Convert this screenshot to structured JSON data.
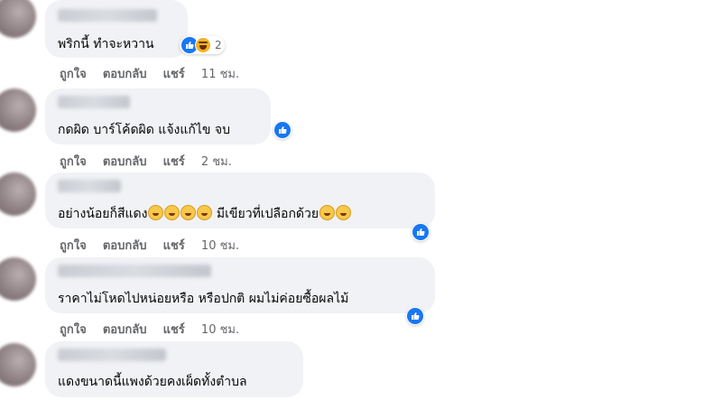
{
  "comments": [
    {
      "text": "พริกนี้ ทำจะหวาน",
      "reaction_count": "2",
      "actions": {
        "like": "ถูกใจ",
        "reply": "ตอบกลับ",
        "share": "แชร์",
        "time": "11 ชม."
      }
    },
    {
      "text": "กดผิด บาร์โค้ดผิด แจ้งแก้ไข จบ",
      "actions": {
        "like": "ถูกใจ",
        "reply": "ตอบกลับ",
        "share": "แชร์",
        "time": "2 ชม."
      }
    },
    {
      "text_a": "อย่างน้อยก็สีแดง",
      "text_b": " มีเขียวที่เปลือกด้วย",
      "actions": {
        "like": "ถูกใจ",
        "reply": "ตอบกลับ",
        "share": "แชร์",
        "time": "10 ชม."
      }
    },
    {
      "text": "ราคาไม่โหดไปหน่อยหรือ หรือปกติ ผมไม่ค่อยซื้อผลไม้",
      "actions": {
        "like": "ถูกใจ",
        "reply": "ตอบกลับ",
        "share": "แชร์",
        "time": "10 ชม."
      }
    },
    {
      "text": "แดงขนาดนี้แพงด้วยคงเผ็ดทั้งตำบล"
    }
  ],
  "colors": {
    "like": "#1877f2",
    "bubble": "#f0f2f5",
    "meta": "#65676b"
  }
}
